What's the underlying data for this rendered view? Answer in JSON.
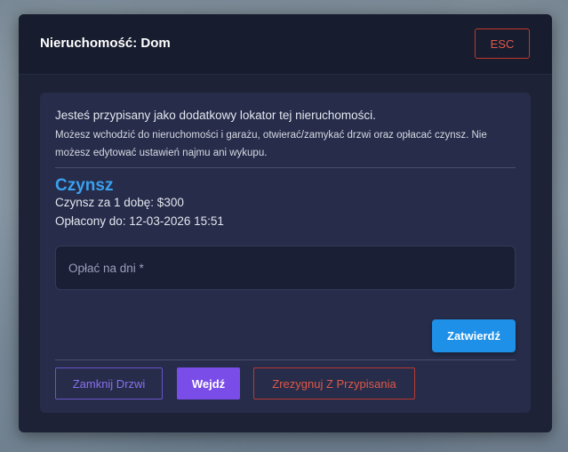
{
  "modal": {
    "title": "Nieruchomość: Dom",
    "esc_label": "ESC"
  },
  "info": {
    "line1": "Jesteś przypisany jako dodatkowy lokator tej nieruchomości.",
    "line2": "Możesz wchodzić do nieruchomości i garażu, otwierać/zamykać drzwi oraz opłacać czynsz. Nie możesz edytować ustawień najmu ani wykupu."
  },
  "rent": {
    "title": "Czynsz",
    "price_line": "Czynsz za 1 dobę: $300",
    "paid_until_line": "Opłacony do: 12-03-2026 15:51"
  },
  "days_input": {
    "placeholder": "Opłać na dni *",
    "value": ""
  },
  "actions": {
    "confirm_label": "Zatwierdź",
    "close_door_label": "Zamknij Drzwi",
    "enter_label": "Wejdź",
    "resign_label": "Zrezygnuj Z Przypisania"
  },
  "colors": {
    "accent_blue": "#1e90e8",
    "rent_title": "#3aa0f0",
    "purple": "#7a4de8",
    "danger": "#e0584a"
  }
}
